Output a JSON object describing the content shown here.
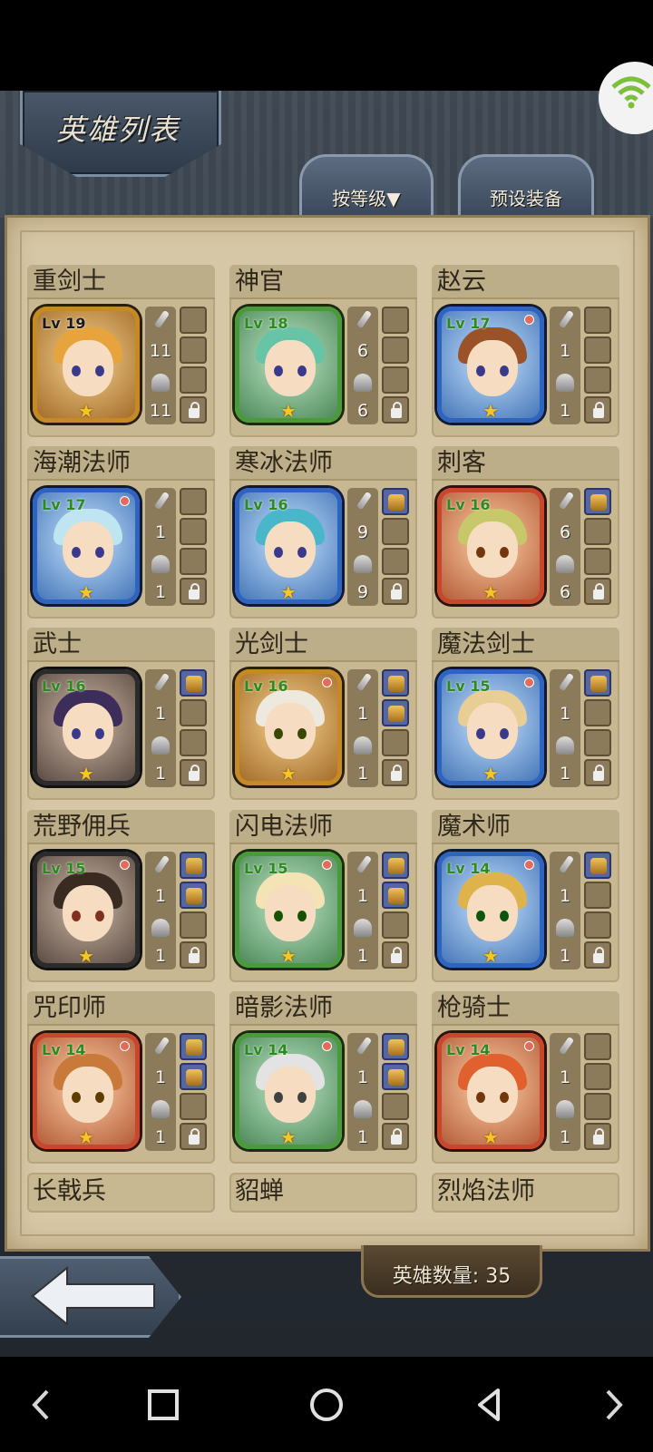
{
  "header": {
    "title": "英雄列表"
  },
  "tabs": {
    "sort_label": "按等级▼",
    "preset_label": "预设装备"
  },
  "heroes": [
    {
      "name": "重剑士",
      "level": "Lv 19",
      "atk": "11",
      "def": "11"
    },
    {
      "name": "神官",
      "level": "Lv 18",
      "atk": "6",
      "def": "6"
    },
    {
      "name": "赵云",
      "level": "Lv 17",
      "atk": "1",
      "def": "1"
    },
    {
      "name": "海潮法师",
      "level": "Lv 17",
      "atk": "1",
      "def": "1"
    },
    {
      "name": "寒冰法师",
      "level": "Lv 16",
      "atk": "9",
      "def": "9"
    },
    {
      "name": "刺客",
      "level": "Lv 16",
      "atk": "6",
      "def": "6"
    },
    {
      "name": "武士",
      "level": "Lv 16",
      "atk": "1",
      "def": "1"
    },
    {
      "name": "光剑士",
      "level": "Lv 16",
      "atk": "1",
      "def": "1"
    },
    {
      "name": "魔法剑士",
      "level": "Lv 15",
      "atk": "1",
      "def": "1"
    },
    {
      "name": "荒野佣兵",
      "level": "Lv 15",
      "atk": "1",
      "def": "1"
    },
    {
      "name": "闪电法师",
      "level": "Lv 15",
      "atk": "1",
      "def": "1"
    },
    {
      "name": "魔术师",
      "level": "Lv 14",
      "atk": "1",
      "def": "1"
    },
    {
      "name": "咒印师",
      "level": "Lv 14",
      "atk": "1",
      "def": "1"
    },
    {
      "name": "暗影法师",
      "level": "Lv 14",
      "atk": "1",
      "def": "1"
    },
    {
      "name": "枪骑士",
      "level": "Lv 14",
      "atk": "1",
      "def": "1"
    }
  ],
  "partial_heroes": [
    {
      "name": "长戟兵"
    },
    {
      "name": "貂蝉"
    },
    {
      "name": "烈焰法师"
    }
  ],
  "footer": {
    "hero_count": "英雄数量: 35"
  }
}
